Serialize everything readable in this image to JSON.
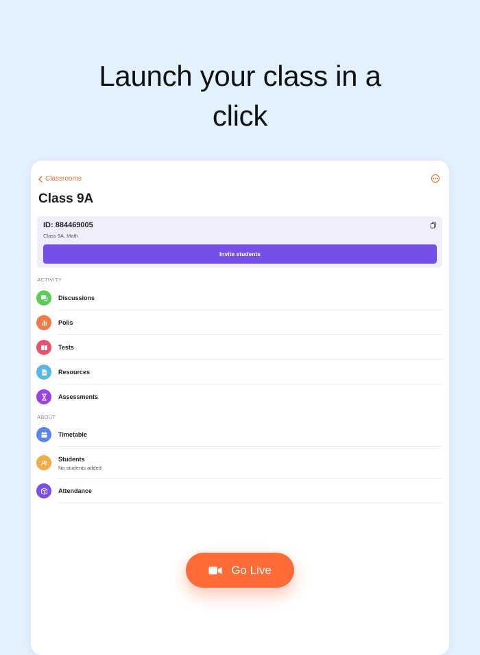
{
  "headline": {
    "line1": "Launch your class in a",
    "line2": "click"
  },
  "nav": {
    "back_label": "Classrooms",
    "more_icon": "more-icon"
  },
  "class": {
    "title": "Class 9A",
    "id_label": "ID: 884469005",
    "subtitle": "Class 9A, Math",
    "invite_label": "Invite students"
  },
  "sections": {
    "activity": "ACTIVITY",
    "about": "ABOUT"
  },
  "activity_items": [
    {
      "label": "Discussions",
      "icon": "chat-icon",
      "color": "#5ccb57"
    },
    {
      "label": "Polls",
      "icon": "bar-chart-icon",
      "color": "#f27a45"
    },
    {
      "label": "Tests",
      "icon": "book-icon",
      "color": "#e8526f"
    },
    {
      "label": "Resources",
      "icon": "document-icon",
      "color": "#5ab8e6"
    },
    {
      "label": "Assessments",
      "icon": "hourglass-icon",
      "color": "#9a43e0"
    }
  ],
  "about_items": [
    {
      "label": "Timetable",
      "icon": "calendar-icon",
      "color": "#5a86ea"
    },
    {
      "label": "Students",
      "sublabel": "No students added",
      "icon": "users-icon",
      "color": "#f3ac45"
    },
    {
      "label": "Attendance",
      "icon": "cube-icon",
      "color": "#7a50e6"
    }
  ],
  "cta": {
    "label": "Go Live",
    "icon": "video-camera-icon"
  },
  "colors": {
    "accent": "#f06a2a",
    "primary": "#7450e8",
    "cta": "#ff6b36",
    "background": "#e3f0fd"
  }
}
